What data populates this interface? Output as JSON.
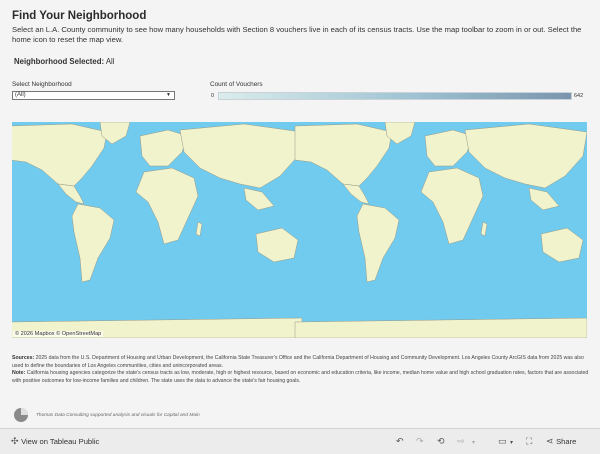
{
  "header": {
    "title": "Find Your Neighborhood",
    "description": "Select an L.A. County community to see how many households with Section 8 vouchers live in each of its census tracts. Use the map toolbar to zoom in or out. Select the home icon to reset the map view.",
    "selected_label": "Neighborhood Selected:",
    "selected_value": "All"
  },
  "filter": {
    "label": "Select Neighborhood",
    "value": "(All)"
  },
  "legend": {
    "label": "Count of Vouchers",
    "min": "0",
    "max": "642",
    "colors": [
      "#dbecec",
      "#9ec3d2",
      "#7b95ad"
    ]
  },
  "map": {
    "attribution": "© 2026 Mapbox  © OpenStreetMap",
    "water_color": "#71cbee",
    "land_color": "#f1f3cc"
  },
  "sources": {
    "sources_label": "Sources:",
    "sources_text": "2025 data from the U.S. Department of Housing and Urban Development, the California State Treasurer's Office and the California Department of Housing and Community Development. Los Angeles County ArcGIS data from 2025 was also used to define the boundaries of Los Angeles communities, cities and unincorporated areas.",
    "note_label": "Note:",
    "note_text": "California housing agencies categorize the state's census tracts as low, moderate, high or highest resource, based on economic and education criteria, like income, median home value and high school graduation rates, factors that are associated with positive outcomes for low-income families and children. The state uses the data to advance the state's fair housing goals."
  },
  "footer": {
    "credit": "Thomas Data Consulting supported analysis and visuals for Capital and Main"
  },
  "toolbar": {
    "view_on_tableau": "View on Tableau Public",
    "share": "Share"
  }
}
